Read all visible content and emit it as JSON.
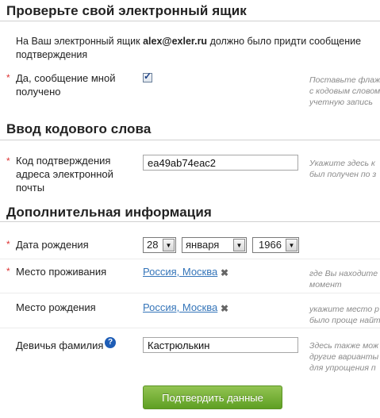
{
  "sections": {
    "check_email": {
      "title": "Проверьте свой электронный ящик",
      "text_before": "На Ваш электронный ящик",
      "email": "alex@exler.ru",
      "text_after": "должно было придти сообщение",
      "text_line2": "подтверждения"
    },
    "code_word": {
      "title": "Ввод кодового слова"
    },
    "additional": {
      "title": "Дополнительная информация"
    }
  },
  "fields": {
    "received": {
      "required_mark": "*",
      "label_line1": "Да, сообщение мной",
      "label_line2": "получено",
      "checked": true,
      "check_glyph": "✓",
      "hint_line1": "Поставьте флаж",
      "hint_line2": "с кодовым словом",
      "hint_line3": "учетную запись"
    },
    "confirmation_code": {
      "required_mark": "*",
      "label_line1": "Код подтверждения",
      "label_line2": "адреса электронной",
      "label_line3": "почты",
      "value": "ea49ab74eac2",
      "hint_line1": "Укажите здесь к",
      "hint_line2": "был получен по з"
    },
    "birth_date": {
      "required_mark": "*",
      "label": "Дата рождения",
      "day": "28",
      "month": "января",
      "year": "1966",
      "arrow_glyph": "▼"
    },
    "residence": {
      "required_mark": "*",
      "label": "Место проживания",
      "value": "Россия, Москва",
      "remove_glyph": "✖",
      "hint_line1": "где Вы находите",
      "hint_line2": "момент"
    },
    "birth_place": {
      "label": "Место рождения",
      "value": "Россия, Москва",
      "remove_glyph": "✖",
      "hint_line1": "укажите место р",
      "hint_line2": "было проще найт"
    },
    "maiden_name": {
      "label": "Девичья фамилия",
      "help_glyph": "?",
      "value": "Кастрюлькин",
      "hint_line1": "Здесь также мож",
      "hint_line2": "другие варианты",
      "hint_line3": "для упрощения п"
    }
  },
  "submit_label": "Подтвердить данные",
  "colors": {
    "required": "#d33333",
    "link": "#3575b9",
    "submit_top": "#93c452",
    "submit_bottom": "#5e9f23",
    "help_icon": "#1e5db6"
  }
}
